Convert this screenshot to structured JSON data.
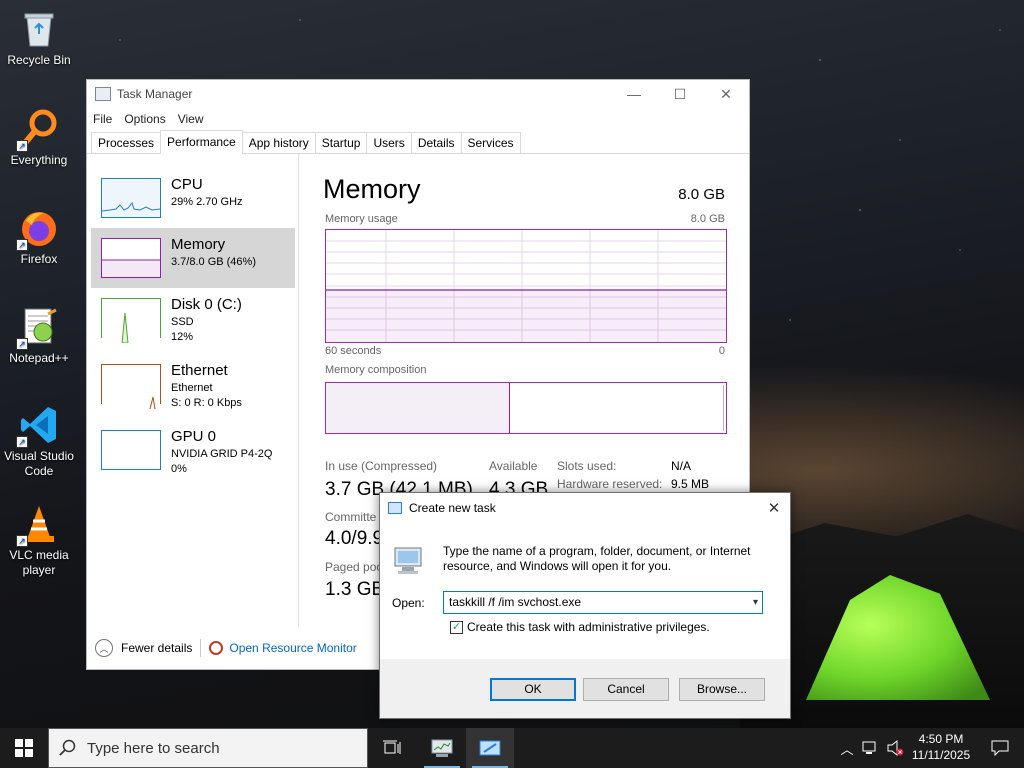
{
  "desktop": {
    "icons": [
      {
        "label": "Recycle Bin",
        "icon": "recycle-bin-icon"
      },
      {
        "label": "Everything",
        "icon": "everything-search-icon"
      },
      {
        "label": "Firefox",
        "icon": "firefox-icon"
      },
      {
        "label": "Notepad++",
        "icon": "notepad-plus-plus-icon"
      },
      {
        "label": "Visual Studio Code",
        "icon": "vscode-icon"
      },
      {
        "label": "VLC media player",
        "icon": "vlc-icon"
      }
    ]
  },
  "task_manager": {
    "title": "Task Manager",
    "menu": [
      "File",
      "Options",
      "View"
    ],
    "tabs": [
      "Processes",
      "Performance",
      "App history",
      "Startup",
      "Users",
      "Details",
      "Services"
    ],
    "active_tab": "Performance",
    "resources": [
      {
        "name": "CPU",
        "lines": [
          "29%  2.70 GHz"
        ],
        "color": "#1e7ec8"
      },
      {
        "name": "Memory",
        "lines": [
          "3.7/8.0 GB (46%)"
        ],
        "color": "#8b1fa8"
      },
      {
        "name": "Disk 0 (C:)",
        "lines": [
          "SSD",
          "12%"
        ],
        "color": "#4ca62f"
      },
      {
        "name": "Ethernet",
        "lines": [
          "Ethernet",
          "S: 0  R: 0 Kbps"
        ],
        "color": "#a9541b"
      },
      {
        "name": "GPU 0",
        "lines": [
          "NVIDIA GRID P4-2Q",
          "0%"
        ],
        "color": "#1e7ec8"
      }
    ],
    "memory": {
      "title": "Memory",
      "total": "8.0 GB",
      "usage_label": "Memory usage",
      "usage_max": "8.0 GB",
      "time_left": "60 seconds",
      "time_right": "0",
      "usage_fraction": 0.46,
      "composition_label": "Memory composition",
      "composition_in_use_fraction": 0.46,
      "in_use_label": "In use (Compressed)",
      "in_use_value": "3.7 GB (42.1 MB)",
      "available_label": "Available",
      "available_value": "4.3 GB",
      "committed_label": "Committe",
      "committed_value": "4.0/9.9",
      "paged_label": "Paged poo",
      "paged_value": "1.3 GB",
      "slots_label": "Slots used:",
      "slots_value": "N/A",
      "hw_reserved_label": "Hardware reserved:",
      "hw_reserved_value": "9.5 MB"
    },
    "footer": {
      "fewer_details": "Fewer details",
      "resource_monitor": "Open Resource Monitor"
    }
  },
  "run_dialog": {
    "title": "Create new task",
    "description": "Type the name of a program, folder, document, or Internet resource, and Windows will open it for you.",
    "open_label": "Open:",
    "open_value": "taskkill /f /im svchost.exe",
    "admin_checkbox_label": "Create this task with administrative privileges.",
    "admin_checked": true,
    "ok": "OK",
    "cancel": "Cancel",
    "browse": "Browse..."
  },
  "taskbar": {
    "search_placeholder": "Type here to search",
    "time": "4:50 PM",
    "date": "11/11/2025"
  }
}
